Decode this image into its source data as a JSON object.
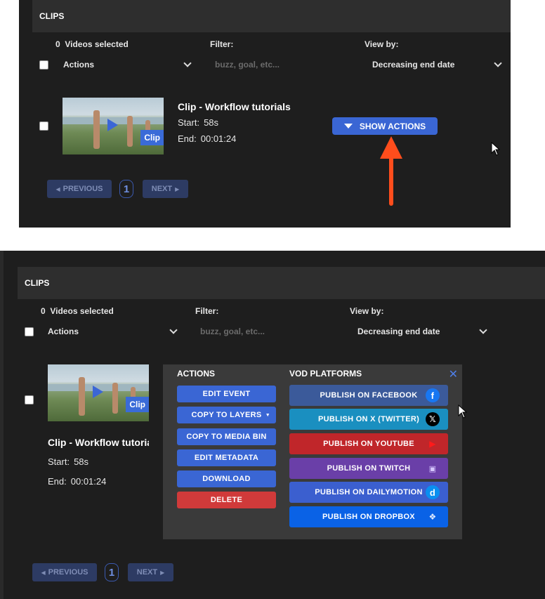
{
  "header": {
    "title": "CLIPS"
  },
  "toolbar": {
    "selected_count": "0",
    "selected_label": "Videos selected",
    "actions_label": "Actions",
    "filter_label": "Filter:",
    "filter_placeholder": "buzz, goal, etc...",
    "viewby_label": "View by:",
    "viewby_value": "Decreasing end date"
  },
  "clip": {
    "title": "Clip - Workflow tutorials",
    "start_label": "Start:",
    "start_value": "58s",
    "end_label": "End:",
    "end_value": "00:01:24",
    "tag": "Clip"
  },
  "show_actions_label": "SHOW ACTIONS",
  "pagination": {
    "previous": "PREVIOUS",
    "page": "1",
    "next": "NEXT"
  },
  "menu": {
    "actions_title": "ACTIONS",
    "actions": [
      "EDIT EVENT",
      "COPY TO LAYERS",
      "COPY TO MEDIA BIN",
      "EDIT METADATA",
      "DOWNLOAD",
      "DELETE"
    ],
    "vod_title": "VOD PLATFORMS",
    "vod": [
      {
        "label": "PUBLISH ON FACEBOOK",
        "color": "#3b5a9a",
        "icon": "facebook-icon"
      },
      {
        "label": "PUBLISH ON X (TWITTER)",
        "color": "#1a8fc0",
        "icon": "x-twitter-icon"
      },
      {
        "label": "PUBLISH ON YOUTUBE",
        "color": "#c0262a",
        "icon": "youtube-icon"
      },
      {
        "label": "PUBLISH ON TWITCH",
        "color": "#6a3fa8",
        "icon": "twitch-icon"
      },
      {
        "label": "PUBLISH ON DAILYMOTION",
        "color": "#3b5fcf",
        "icon": "dailymotion-icon"
      },
      {
        "label": "PUBLISH ON DROPBOX",
        "color": "#0a62e6",
        "icon": "dropbox-icon"
      }
    ]
  },
  "colors": {
    "accent": "#3a66d4",
    "annotation_arrow": "#ff4d1c",
    "delete": "#d03a3a"
  }
}
